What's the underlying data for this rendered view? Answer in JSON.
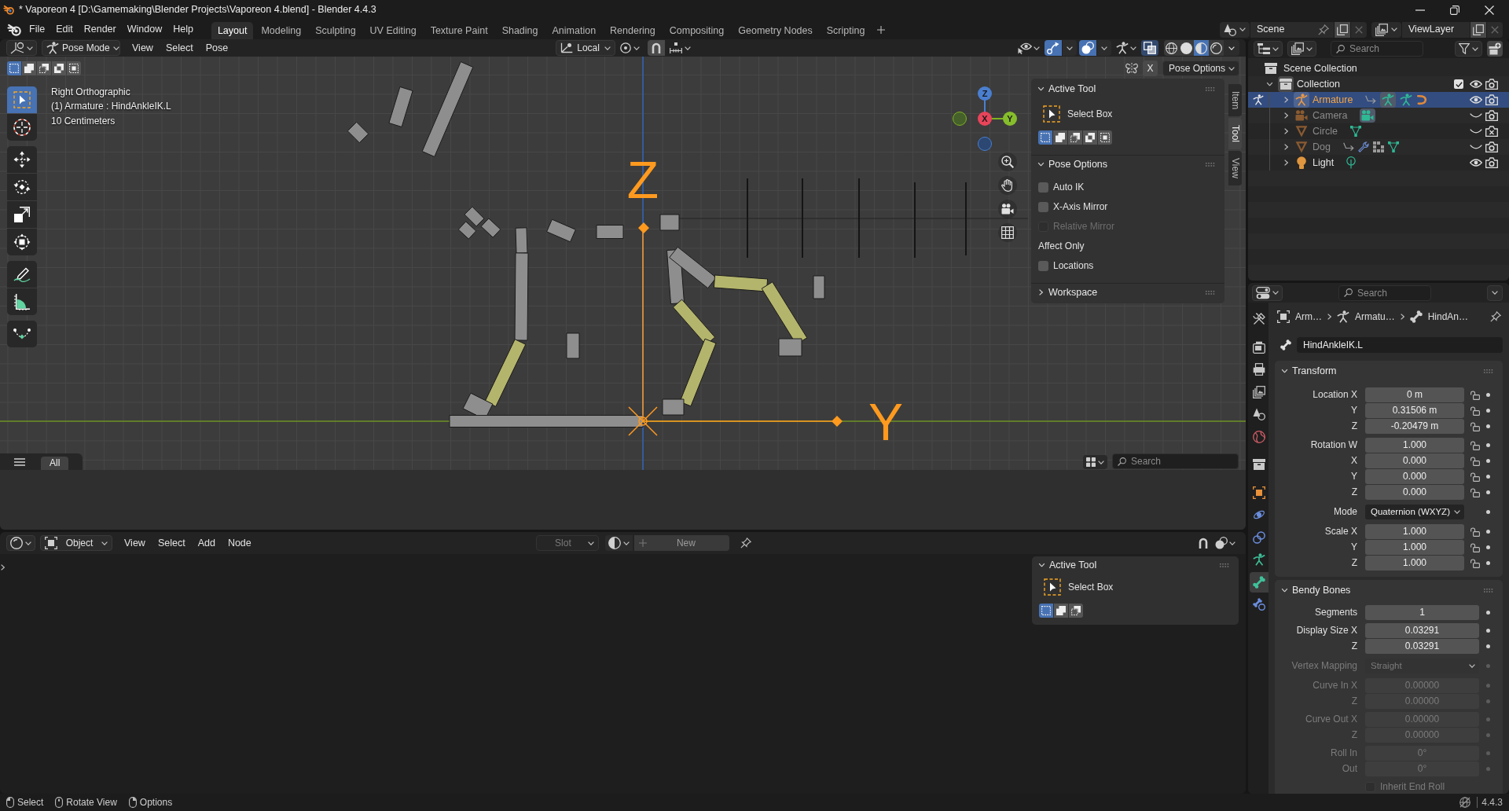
{
  "window": {
    "title": "* Vaporeon 4 [D:\\Gamemaking\\Blender Projects\\Vaporeon 4.blend] - Blender 4.4.3"
  },
  "menu": [
    "File",
    "Edit",
    "Render",
    "Window",
    "Help"
  ],
  "workspaces": [
    {
      "label": "Layout",
      "selected": true
    },
    {
      "label": "Modeling",
      "selected": false
    },
    {
      "label": "Sculpting",
      "selected": false
    },
    {
      "label": "UV Editing",
      "selected": false
    },
    {
      "label": "Texture Paint",
      "selected": false
    },
    {
      "label": "Shading",
      "selected": false
    },
    {
      "label": "Animation",
      "selected": false
    },
    {
      "label": "Rendering",
      "selected": false
    },
    {
      "label": "Compositing",
      "selected": false
    },
    {
      "label": "Geometry Nodes",
      "selected": false
    },
    {
      "label": "Scripting",
      "selected": false
    }
  ],
  "scene": "Scene",
  "view_layer": "ViewLayer",
  "viewport": {
    "header": {
      "mode": "Pose Mode",
      "menus": [
        "View",
        "Select",
        "Pose"
      ],
      "orientation": "Local",
      "toggles": [
        {
          "kind": "visibility",
          "on": false
        },
        {
          "kind": "gizmos",
          "on": true
        },
        {
          "kind": "overlays",
          "on": true
        },
        {
          "kind": "bones",
          "on": false
        },
        {
          "kind": "xray",
          "on": true
        }
      ],
      "shading": [
        {
          "kind": "wireframe",
          "selected": false
        },
        {
          "kind": "solid",
          "selected": false
        },
        {
          "kind": "material",
          "selected": true
        },
        {
          "kind": "rendered",
          "selected": false
        }
      ]
    },
    "select_modes": [
      {
        "kind": "set",
        "selected": true
      },
      {
        "kind": "extend",
        "selected": false
      },
      {
        "kind": "subtract",
        "selected": false
      },
      {
        "kind": "difference",
        "selected": false
      },
      {
        "kind": "intersect",
        "selected": false
      }
    ],
    "mirror_toggle": {
      "label": "X",
      "on": false
    },
    "options_menu": "Pose Options",
    "tool_groups": [
      {
        "tools": [
          {
            "kind": "select_box",
            "selected": true
          },
          {
            "kind": "cursor",
            "selected": false
          }
        ]
      },
      {
        "tools": [
          {
            "kind": "move",
            "selected": false
          },
          {
            "kind": "rotate",
            "selected": false
          },
          {
            "kind": "scale",
            "selected": false
          },
          {
            "kind": "transform",
            "selected": false
          }
        ]
      },
      {
        "tools": [
          {
            "kind": "annotate",
            "selected": false
          },
          {
            "kind": "measure",
            "selected": false
          }
        ]
      },
      {
        "tools": [
          {
            "kind": "roll",
            "selected": false
          }
        ]
      }
    ],
    "info": [
      "Right Orthographic",
      "(1) Armature : HindAnkleIK.L",
      "10 Centimeters"
    ],
    "gizmo": {
      "x": "X",
      "y": "Y",
      "z": "Z"
    },
    "bone_axis_labels": [
      "Z",
      "Y"
    ],
    "sidebar": {
      "tabs": [
        {
          "label": "Item",
          "selected": false
        },
        {
          "label": "Tool",
          "selected": true
        },
        {
          "label": "View",
          "selected": false
        }
      ],
      "active_tool": {
        "title": "Active Tool",
        "expanded": true,
        "tool": "Select Box",
        "modes": [
          {
            "kind": "set",
            "selected": true
          },
          {
            "kind": "extend",
            "selected": false
          },
          {
            "kind": "subtract",
            "selected": false
          },
          {
            "kind": "difference",
            "selected": false
          },
          {
            "kind": "intersect",
            "selected": false
          }
        ]
      },
      "pose_options": {
        "title": "Pose Options",
        "expanded": true,
        "options": [
          {
            "label": "Auto IK",
            "checked": false,
            "disabled": false
          },
          {
            "label": "X-Axis Mirror",
            "checked": false,
            "disabled": false
          },
          {
            "label": "Relative Mirror",
            "checked": false,
            "disabled": true
          }
        ],
        "affect_only": {
          "title": "Affect Only",
          "options": [
            {
              "label": "Locations",
              "checked": false,
              "disabled": false
            }
          ]
        }
      },
      "workspace": {
        "title": "Workspace",
        "expanded": false
      }
    },
    "asset_shelf": {
      "tab": "All",
      "search_placeholder": "Search"
    }
  },
  "node_editor": {
    "header": {
      "context": "Object",
      "menus": [
        "View",
        "Select",
        "Add",
        "Node"
      ],
      "slot": "Slot",
      "new_button": "New"
    },
    "sidebar": {
      "title": "Active Tool",
      "expanded": true,
      "tool": "Select Box",
      "modes": [
        {
          "kind": "set",
          "selected": true
        },
        {
          "kind": "extend",
          "selected": false
        },
        {
          "kind": "subtract",
          "selected": false
        }
      ]
    }
  },
  "outliner": {
    "search_placeholder": "Search",
    "root": "Scene Collection",
    "collection": {
      "name": "Collection",
      "expanded": true,
      "included": true,
      "visible": true,
      "renderable": true,
      "children": [
        {
          "name": "Armature",
          "kind": "armature",
          "selected": true,
          "expanded": false,
          "posing": true,
          "visible": true,
          "renderable": true,
          "data": [
            {
              "kind": "parent",
              "active": false
            },
            {
              "kind": "armature",
              "active": true
            },
            {
              "kind": "pose",
              "active": false
            },
            {
              "kind": "hook",
              "active": false
            }
          ]
        },
        {
          "name": "Camera",
          "kind": "camera",
          "selected": false,
          "expanded": false,
          "posing": false,
          "visible": false,
          "renderable": true,
          "data": [
            {
              "kind": "camera",
              "active": true
            }
          ]
        },
        {
          "name": "Circle",
          "kind": "mesh",
          "selected": false,
          "expanded": false,
          "posing": false,
          "visible": false,
          "renderable": false,
          "data": [
            {
              "kind": "mesh",
              "active": false
            }
          ]
        },
        {
          "name": "Dog",
          "kind": "mesh",
          "selected": false,
          "expanded": false,
          "posing": false,
          "visible": false,
          "renderable": true,
          "data": [
            {
              "kind": "parent",
              "active": false
            },
            {
              "kind": "modifier",
              "active": false
            },
            {
              "kind": "groups",
              "active": false
            },
            {
              "kind": "mesh",
              "active": false
            }
          ]
        },
        {
          "name": "Light",
          "kind": "light",
          "selected": false,
          "expanded": false,
          "posing": false,
          "visible": true,
          "renderable": true,
          "data": [
            {
              "kind": "light",
              "active": false
            }
          ]
        }
      ]
    }
  },
  "properties": {
    "search_placeholder": "Search",
    "tabs": [
      {
        "kind": "tool",
        "selected": false
      },
      {
        "kind": "render",
        "selected": false
      },
      {
        "kind": "output",
        "selected": false
      },
      {
        "kind": "view_layer",
        "selected": false
      },
      {
        "kind": "scene",
        "selected": false
      },
      {
        "kind": "world",
        "selected": false
      },
      {
        "kind": "collection",
        "selected": false
      },
      {
        "kind": "object",
        "selected": false
      },
      {
        "kind": "physics",
        "selected": false
      },
      {
        "kind": "constraints",
        "selected": false
      },
      {
        "kind": "data",
        "selected": false
      },
      {
        "kind": "bone",
        "selected": true
      },
      {
        "kind": "bone_constraints",
        "selected": false
      }
    ],
    "breadcrumb": [
      {
        "kind": "object",
        "label": "Arm…"
      },
      {
        "kind": "armature",
        "label": "Armatu…"
      },
      {
        "kind": "bone",
        "label": "HindAn…"
      }
    ],
    "bone_name": "HindAnkleIK.L",
    "transform": {
      "title": "Transform",
      "expanded": true,
      "location": [
        {
          "label": "Location X",
          "value": "0 m",
          "locked": false
        },
        {
          "label": "Y",
          "value": "0.31506 m",
          "locked": false
        },
        {
          "label": "Z",
          "value": "-0.20479 m",
          "locked": false
        }
      ],
      "rotation": [
        {
          "label": "Rotation W",
          "value": "1.000",
          "locked": false
        },
        {
          "label": "X",
          "value": "0.000",
          "locked": false
        },
        {
          "label": "Y",
          "value": "0.000",
          "locked": false
        },
        {
          "label": "Z",
          "value": "0.000",
          "locked": false
        }
      ],
      "mode": {
        "label": "Mode",
        "value": "Quaternion (WXYZ)"
      },
      "scale": [
        {
          "label": "Scale X",
          "value": "1.000",
          "locked": false
        },
        {
          "label": "Y",
          "value": "1.000",
          "locked": false
        },
        {
          "label": "Z",
          "value": "1.000",
          "locked": false
        }
      ]
    },
    "bendy_bones": {
      "title": "Bendy Bones",
      "expanded": true,
      "groups": [
        {
          "rows": [
            {
              "kind": "number",
              "label": "Segments",
              "value": "1",
              "disabled": false
            }
          ]
        },
        {
          "rows": [
            {
              "kind": "number",
              "label": "Display Size X",
              "value": "0.03291",
              "disabled": false
            },
            {
              "kind": "number",
              "label": "Z",
              "value": "0.03291",
              "disabled": false
            }
          ]
        },
        {
          "rows": [
            {
              "kind": "dropdown",
              "label": "Vertex Mapping",
              "value": "Straight",
              "disabled": true
            }
          ]
        },
        {
          "rows": [
            {
              "kind": "number",
              "label": "Curve In X",
              "value": "0.00000",
              "disabled": true
            },
            {
              "kind": "number",
              "label": "Z",
              "value": "0.00000",
              "disabled": true
            }
          ]
        },
        {
          "rows": [
            {
              "kind": "number",
              "label": "Curve Out X",
              "value": "0.00000",
              "disabled": true
            },
            {
              "kind": "number",
              "label": "Z",
              "value": "0.00000",
              "disabled": true
            }
          ]
        },
        {
          "rows": [
            {
              "kind": "number",
              "label": "Roll In",
              "value": "0°",
              "disabled": true
            },
            {
              "kind": "number",
              "label": "Out",
              "value": "0°",
              "disabled": true
            }
          ]
        },
        {
          "rows": [
            {
              "kind": "checkbox",
              "label": "Inherit End Roll",
              "checked": false,
              "disabled": true
            }
          ]
        }
      ]
    }
  },
  "status_bar": {
    "hints": [
      {
        "kind": "left",
        "label": "Select"
      },
      {
        "kind": "middle",
        "label": "Rotate View"
      },
      {
        "kind": "right",
        "label": "Options"
      }
    ],
    "version": "4.4.3"
  }
}
